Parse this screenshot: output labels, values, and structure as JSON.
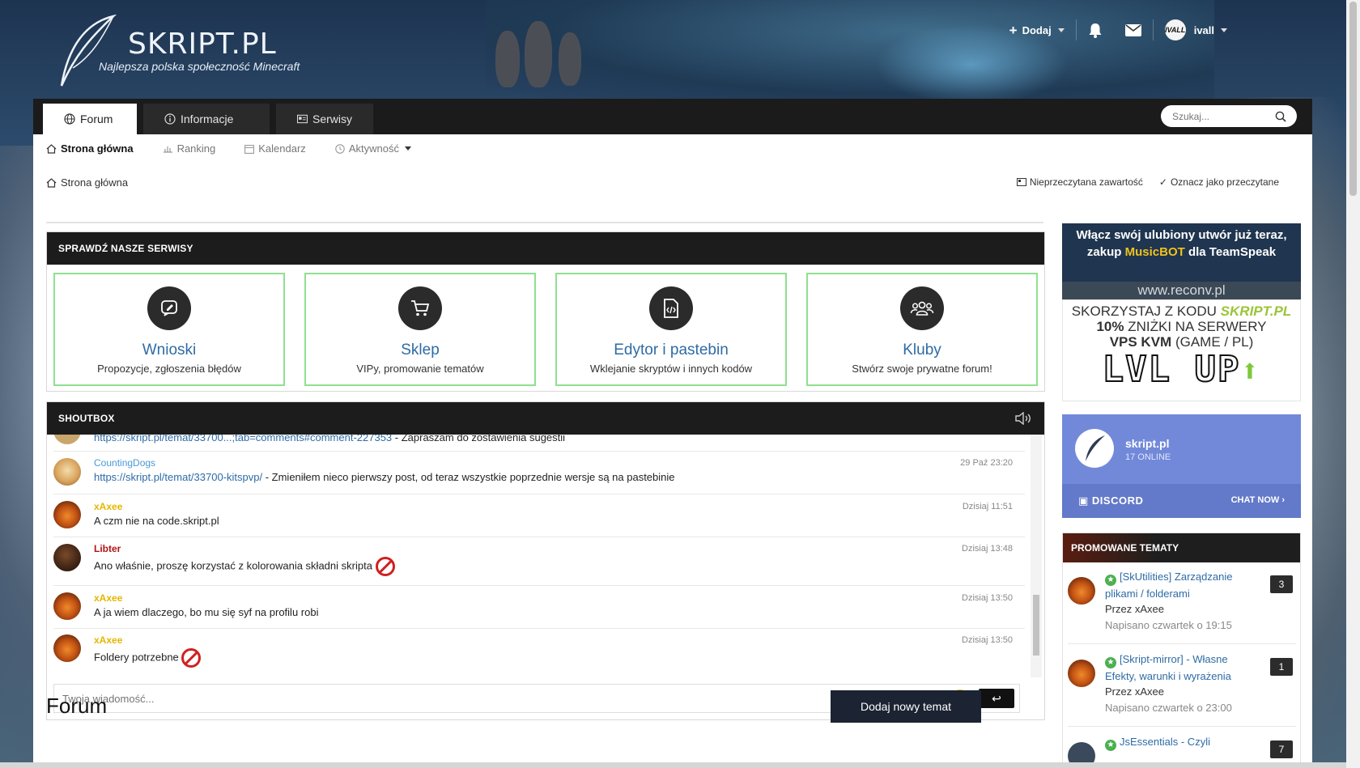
{
  "site": {
    "name": "SKRIPT.PL",
    "tagline": "Najlepsza polska społeczność Minecraft"
  },
  "topbar": {
    "add_label": "Dodaj",
    "username": "ivall",
    "avatar_text": "IVALL"
  },
  "nav": {
    "tabs": [
      {
        "label": "Forum",
        "icon": "globe-icon",
        "active": true
      },
      {
        "label": "Informacje",
        "icon": "info-icon",
        "active": false
      },
      {
        "label": "Serwisy",
        "icon": "id-card-icon",
        "active": false
      }
    ],
    "search_placeholder": "Szukaj..."
  },
  "subnav": [
    {
      "label": "Strona główna",
      "icon": "home-icon"
    },
    {
      "label": "Ranking",
      "icon": "bar-chart-icon"
    },
    {
      "label": "Kalendarz",
      "icon": "calendar-icon"
    },
    {
      "label": "Aktywność",
      "icon": "clock-icon"
    }
  ],
  "breadcrumb": {
    "label": "Strona główna",
    "unread": "Nieprzeczytana zawartość",
    "mark_read": "Oznacz jako przeczytane"
  },
  "services": {
    "title": "SPRAWDŹ NASZE SERWISY",
    "items": [
      {
        "title": "Wnioski",
        "desc": "Propozycje, zgłoszenia błędów",
        "icon": "edit-icon"
      },
      {
        "title": "Sklep",
        "desc": "VIPy, promowanie tematów",
        "icon": "cart-icon"
      },
      {
        "title": "Edytor i pastebin",
        "desc": "Wklejanie skryptów i innych kodów",
        "icon": "code-file-icon"
      },
      {
        "title": "Kluby",
        "desc": "Stwórz swoje prywatne forum!",
        "icon": "users-icon"
      }
    ]
  },
  "shoutbox": {
    "title": "SHOUTBOX",
    "input_placeholder": "Twoja wiadomość...",
    "messages": [
      {
        "user": "",
        "link": "https://skript.pl/temat/33700...;tab=comments#comment-227353",
        "text": " - Zapraszam do zostawienia sugestii",
        "time": ""
      },
      {
        "user": "CountingDogs",
        "link": "https://skript.pl/temat/33700-kitspvp/",
        "text": " - Zmieniłem nieco pierwszy post, od teraz wszystkie poprzednie wersje są na pastebinie",
        "time": "29 Paź 23:20"
      },
      {
        "user": "xAxee",
        "link": "",
        "text": "A czm nie na code.skript.pl",
        "time": "Dzisiaj 11:51"
      },
      {
        "user": "Libter",
        "link": "",
        "text": "Ano właśnie, proszę korzystać z kolorowania składni skripta",
        "time": "Dzisiaj 13:48"
      },
      {
        "user": "xAxee",
        "link": "",
        "text": "A ja wiem dlaczego, bo mu się syf na profilu robi",
        "time": "Dzisiaj 13:50"
      },
      {
        "user": "xAxee",
        "link": "",
        "text": "Foldery potrzebne",
        "time": "Dzisiaj 13:50"
      }
    ]
  },
  "forum": {
    "title": "Forum",
    "new_topic": "Dodaj nowy temat"
  },
  "sidebar": {
    "musicbot": {
      "line1": "Włącz swój ulubiony utwór już teraz,",
      "line2a": "zakup ",
      "line2b": "MusicBOT",
      "line2c": " dla TeamSpeak",
      "url": "www.reconv.pl"
    },
    "lvlup": {
      "line1a": "SKORZYSTAJ Z KODU ",
      "code": "SKRIPT.PL",
      "line2a": "10%",
      "line2b": " ZNIŻKI NA SERWERY",
      "line3a": "VPS KVM",
      "line3b": " (GAME / PL)",
      "logo": "LVL UP"
    },
    "discord": {
      "server": "skript.pl",
      "online": "17 ONLINE",
      "brand": "DISCORD",
      "cta": "CHAT NOW"
    },
    "promoted": {
      "title": "PROMOWANE TEMATY",
      "items": [
        {
          "title": "[SkUtilities] Zarządzanie plikami / folderami",
          "author": "Przez xAxee",
          "date": "Napisano czwartek o 19:15",
          "count": "3"
        },
        {
          "title": "[Skript-mirror] - Własne Efekty, warunki i wyrażenia",
          "author": "Przez xAxee",
          "date": "Napisano czwartek o 23:00",
          "count": "1"
        },
        {
          "title": "JsEssentials - Czyli",
          "author": "",
          "date": "",
          "count": "7"
        }
      ]
    }
  },
  "colors": {
    "accent_link": "#2e6ba6",
    "service_border": "#8fe08f",
    "dark_header": "#1c1c1c",
    "discord": "#7289da",
    "username_gold": "#e6b600",
    "username_red": "#b01515"
  }
}
